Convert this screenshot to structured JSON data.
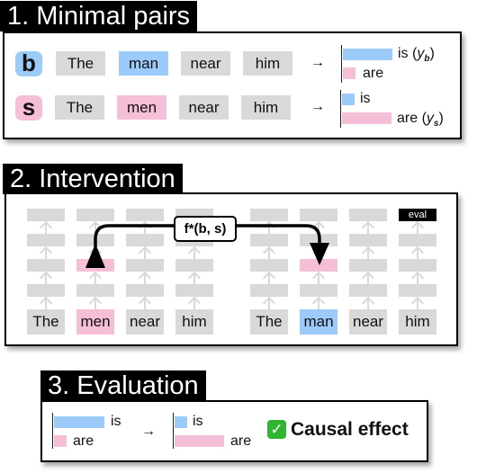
{
  "colors": {
    "blue": "#9ccbfa",
    "pink": "#f5bfd7",
    "grey": "#d9d9d9"
  },
  "section1": {
    "title": "1. Minimal pairs",
    "rows": [
      {
        "badge": "b",
        "tokens": [
          "The",
          "man",
          "near",
          "him"
        ],
        "highlight": 1,
        "color": "blue",
        "arrow": "→",
        "outputs": [
          {
            "label": "is (",
            "sym": "y",
            "sub": "b",
            "close": ")",
            "value": 1.0
          },
          {
            "label": "are",
            "value": 0.25
          }
        ]
      },
      {
        "badge": "s",
        "tokens": [
          "The",
          "men",
          "near",
          "him"
        ],
        "highlight": 1,
        "color": "pink",
        "arrow": "→",
        "outputs": [
          {
            "label": "is",
            "value": 0.25
          },
          {
            "label": "are (",
            "sym": "y",
            "sub": "s",
            "close": ")",
            "value": 1.0
          }
        ]
      }
    ]
  },
  "section2": {
    "title": "2. Intervention",
    "left_tokens": [
      "The",
      "men",
      "near",
      "him"
    ],
    "right_tokens": [
      "The",
      "man",
      "near",
      "him"
    ],
    "function_label": "f*(",
    "function_b": "b",
    "function_sep": ", ",
    "function_s": "s",
    "function_close": ")",
    "eval_label": "eval"
  },
  "section3": {
    "title": "3. Evaluation",
    "before": [
      {
        "label": "is",
        "value": 1.0
      },
      {
        "label": "are",
        "value": 0.25
      }
    ],
    "arrow": "→",
    "after": [
      {
        "label": "is",
        "value": 0.25
      },
      {
        "label": "are",
        "value": 1.0
      }
    ],
    "check_icon": "✅",
    "result": "Causal effect"
  }
}
